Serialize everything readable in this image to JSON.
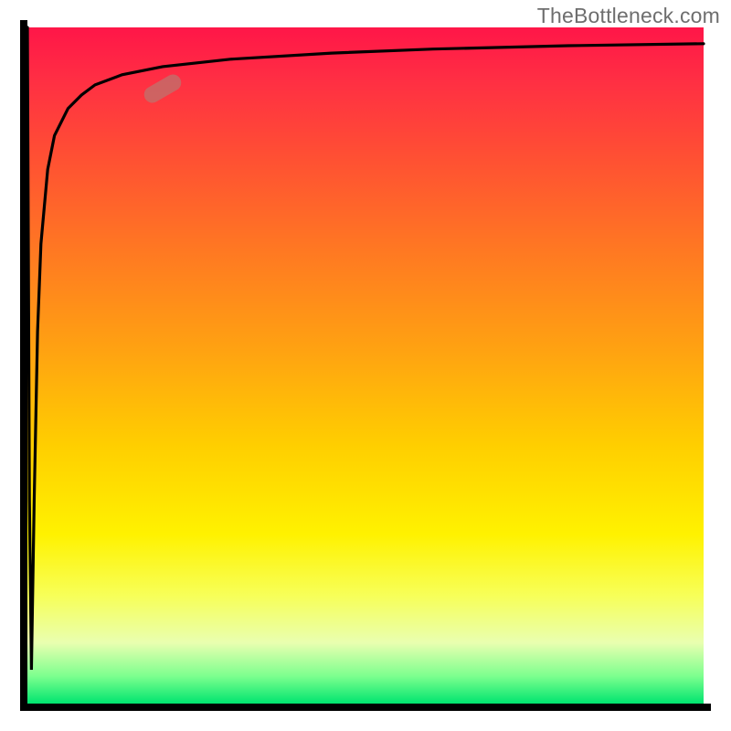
{
  "watermark": "TheBottleneck.com",
  "colors": {
    "axis": "#000000",
    "curve": "#000000",
    "marker_fill": "rgba(190,115,110,0.75)",
    "gradient_top": "#ff1648",
    "gradient_bottom": "#00e46f"
  },
  "chart_data": {
    "type": "line",
    "title": "",
    "xlabel": "",
    "ylabel": "",
    "xlim": [
      0,
      100
    ],
    "ylim": [
      0,
      100
    ],
    "x": [
      0,
      0.3,
      0.6,
      1,
      1.5,
      2,
      3,
      4,
      6,
      8,
      10,
      14,
      20,
      30,
      45,
      60,
      80,
      100
    ],
    "values": [
      100,
      30,
      5,
      30,
      55,
      68,
      79,
      84,
      88,
      90,
      91.5,
      93,
      94.2,
      95.3,
      96.2,
      96.8,
      97.3,
      97.6
    ],
    "annotations": [
      {
        "name": "highlight-segment",
        "x": 20,
        "y": 91,
        "angle_deg": -30
      }
    ],
    "grid": false,
    "legend": false
  }
}
